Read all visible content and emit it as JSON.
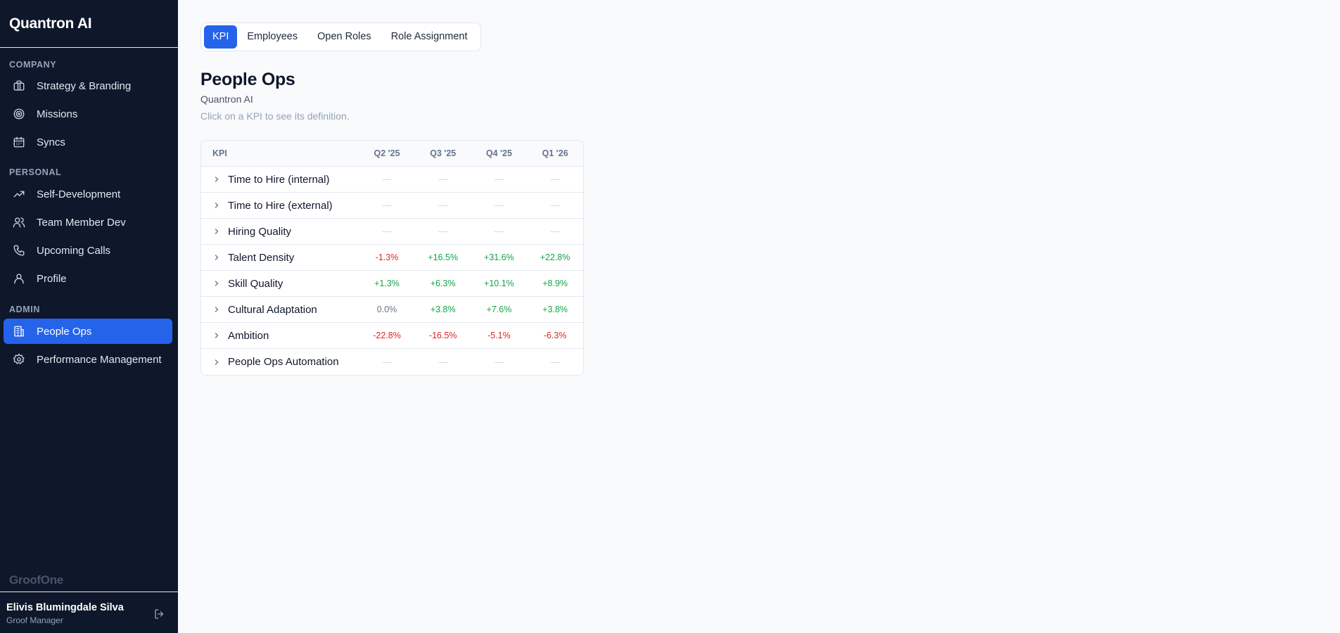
{
  "brand": {
    "title": "Quantron AI"
  },
  "sidebar": {
    "sections": [
      {
        "label": "Company",
        "items": [
          {
            "label": "Strategy & Branding",
            "icon": "briefcase-icon"
          },
          {
            "label": "Missions",
            "icon": "target-icon"
          },
          {
            "label": "Syncs",
            "icon": "calendar-icon"
          }
        ]
      },
      {
        "label": "Personal",
        "items": [
          {
            "label": "Self-Development",
            "icon": "trending-up-icon"
          },
          {
            "label": "Team Member Dev",
            "icon": "users-icon"
          },
          {
            "label": "Upcoming Calls",
            "icon": "phone-icon"
          },
          {
            "label": "Profile",
            "icon": "user-icon"
          }
        ]
      },
      {
        "label": "Admin",
        "items": [
          {
            "label": "People Ops",
            "icon": "building-icon",
            "active": true
          },
          {
            "label": "Performance Management",
            "icon": "gear-icon"
          }
        ]
      }
    ],
    "footer_brand": "GroofOne",
    "user": {
      "name": "Elivis Blumingdale Silva",
      "role": "Groof Manager"
    }
  },
  "tabs": [
    {
      "label": "KPI",
      "active": true
    },
    {
      "label": "Employees"
    },
    {
      "label": "Open Roles"
    },
    {
      "label": "Role Assignment"
    }
  ],
  "page": {
    "title": "People Ops",
    "subtitle": "Quantron AI",
    "hint": "Click on a KPI to see its definition."
  },
  "table": {
    "columns": [
      "KPI",
      "Q2 '25",
      "Q3 '25",
      "Q4 '25",
      "Q1 '26"
    ],
    "rows": [
      {
        "name": "Time to Hire (internal)",
        "values": [
          "—",
          "—",
          "—",
          "—"
        ]
      },
      {
        "name": "Time to Hire (external)",
        "values": [
          "—",
          "—",
          "—",
          "—"
        ]
      },
      {
        "name": "Hiring Quality",
        "values": [
          "—",
          "—",
          "—",
          "—"
        ]
      },
      {
        "name": "Talent Density",
        "values": [
          "-1.3%",
          "+16.5%",
          "+31.6%",
          "+22.8%"
        ]
      },
      {
        "name": "Skill Quality",
        "values": [
          "+1.3%",
          "+6.3%",
          "+10.1%",
          "+8.9%"
        ]
      },
      {
        "name": "Cultural Adaptation",
        "values": [
          "0.0%",
          "+3.8%",
          "+7.6%",
          "+3.8%"
        ]
      },
      {
        "name": "Ambition",
        "values": [
          "-22.8%",
          "-16.5%",
          "-5.1%",
          "-6.3%"
        ]
      },
      {
        "name": "People Ops Automation",
        "values": [
          "—",
          "—",
          "—",
          "—"
        ]
      }
    ]
  },
  "colors": {
    "sidebar_bg": "#0f172a",
    "accent": "#2563eb",
    "positive": "#16a34a",
    "negative": "#dc2626"
  }
}
